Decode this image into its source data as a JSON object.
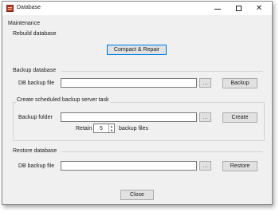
{
  "window": {
    "title": "Database",
    "app_icon": "database-app-icon",
    "controls": {
      "minimize": "─",
      "maximize": "☐",
      "close": "✕"
    }
  },
  "maintenance": {
    "group_label": "Maintenance",
    "rebuild_label": "Rebuild database",
    "compact_button": "Compact & Repair"
  },
  "backup": {
    "section_label": "Backup database",
    "file_label": "DB backup file",
    "file_value": "",
    "browse_button": "...",
    "backup_button": "Backup"
  },
  "scheduled": {
    "group_label": "Create scheduled backup server task",
    "folder_label": "Backup folder",
    "folder_value": "",
    "browse_button": "...",
    "create_button": "Create",
    "retain_label": "Retain",
    "retain_value": "5",
    "retain_suffix": "backup files"
  },
  "restore": {
    "section_label": "Restore database",
    "file_label": "DB backup file",
    "file_value": "",
    "browse_button": "...",
    "restore_button": "Restore"
  },
  "footer": {
    "close_button": "Close"
  }
}
